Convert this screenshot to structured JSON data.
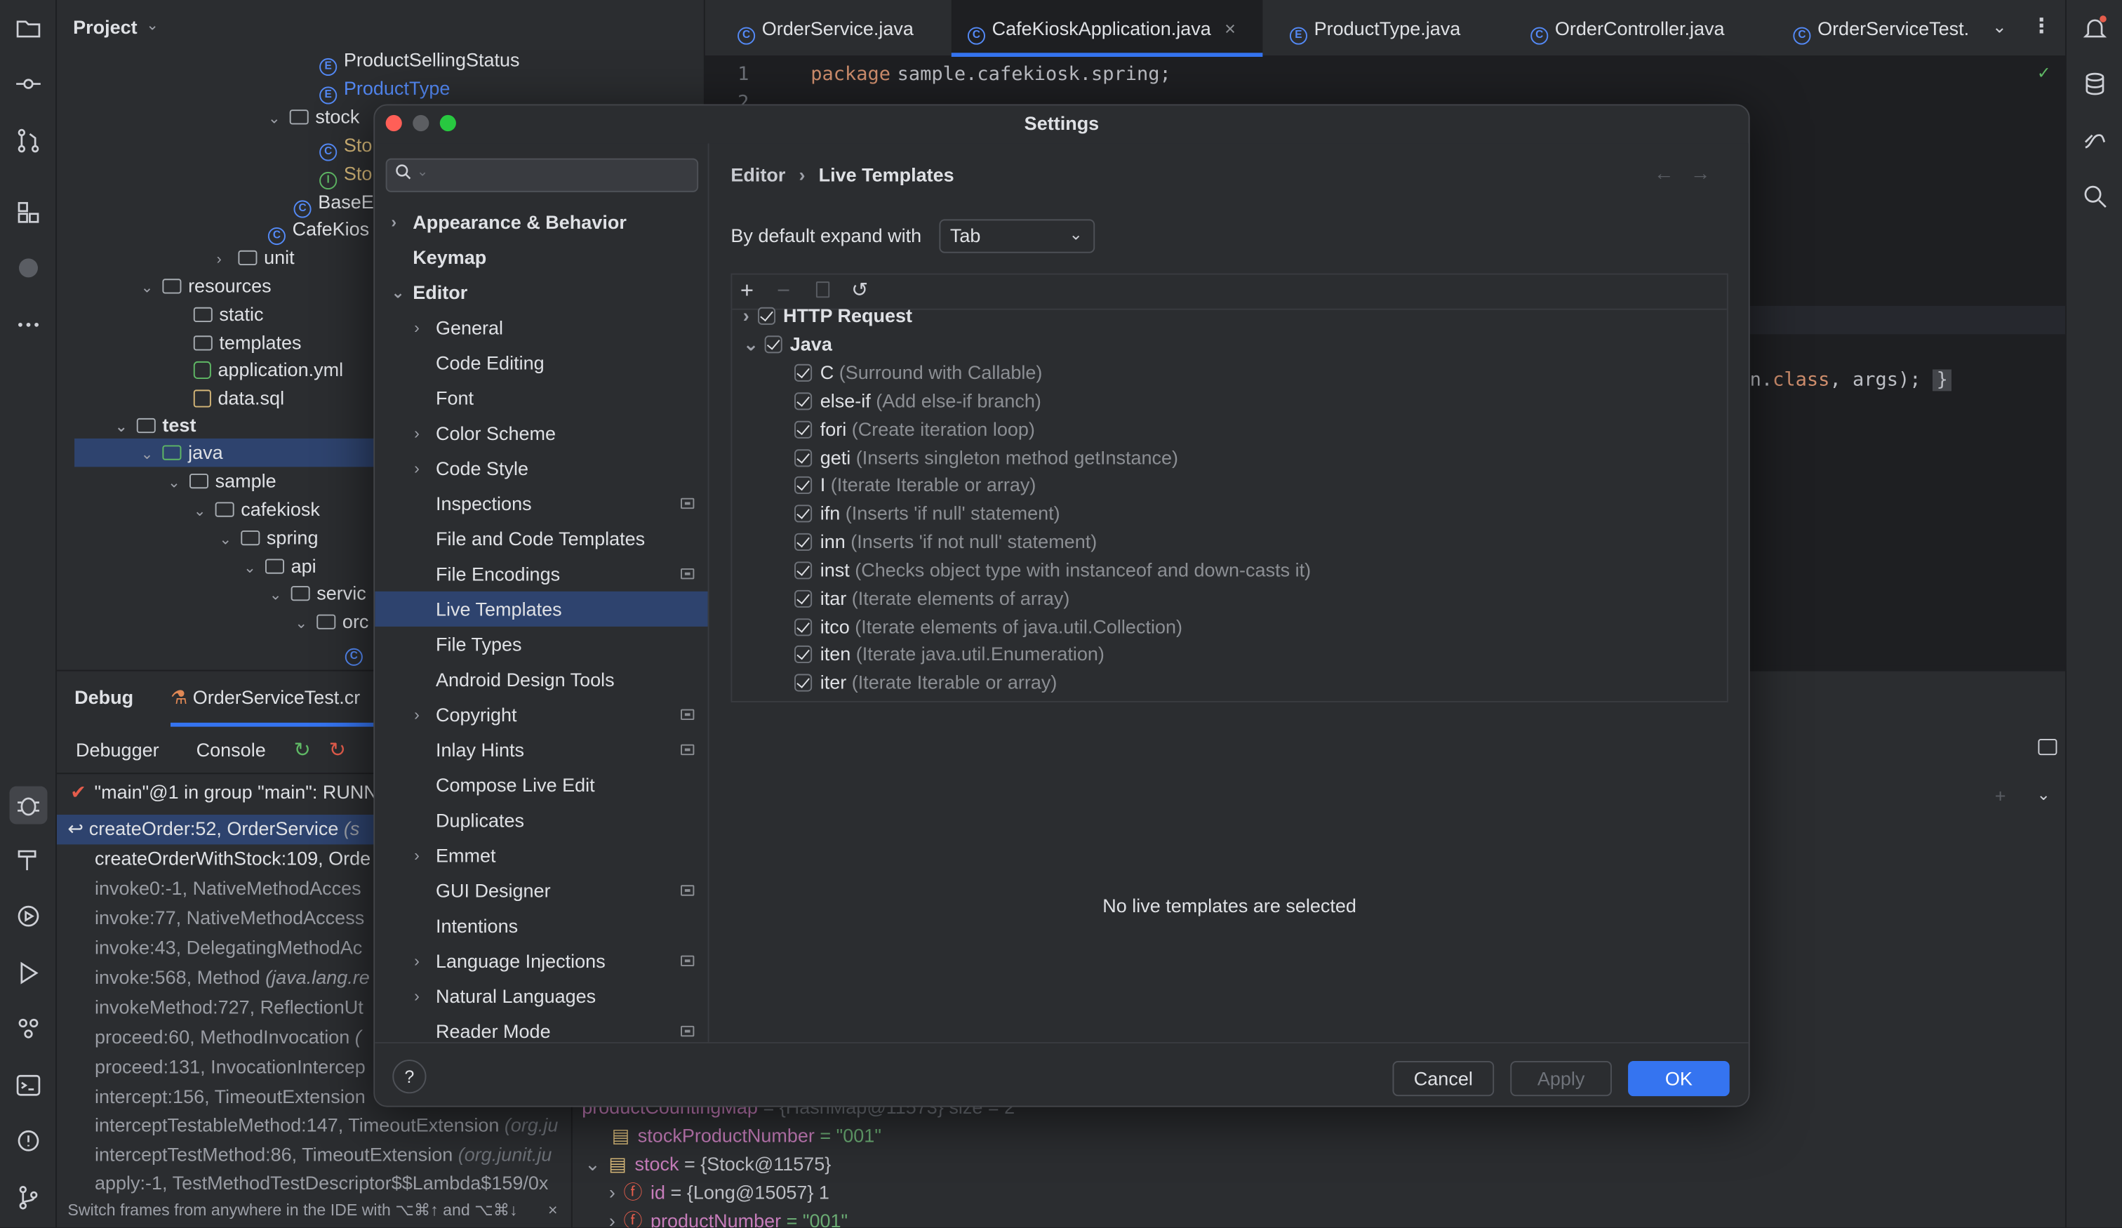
{
  "project": {
    "title": "Project",
    "tree": [
      {
        "label": "ProductSellingStatus",
        "kind": "enum"
      },
      {
        "label": "ProductType",
        "kind": "enum"
      },
      {
        "label": "stock",
        "kind": "folder"
      },
      {
        "label": "Sto",
        "kind": "class"
      },
      {
        "label": "Sto",
        "kind": "interface"
      },
      {
        "label": "BaseE",
        "kind": "class"
      },
      {
        "label": "CafeKios",
        "kind": "class"
      },
      {
        "label": "unit",
        "kind": "folder"
      },
      {
        "label": "resources",
        "kind": "folder"
      },
      {
        "label": "static",
        "kind": "folder"
      },
      {
        "label": "templates",
        "kind": "folder"
      },
      {
        "label": "application.yml",
        "kind": "file"
      },
      {
        "label": "data.sql",
        "kind": "file"
      },
      {
        "label": "test",
        "kind": "folder"
      },
      {
        "label": "java",
        "kind": "folder"
      },
      {
        "label": "sample",
        "kind": "folder"
      },
      {
        "label": "cafekiosk",
        "kind": "folder"
      },
      {
        "label": "spring",
        "kind": "folder"
      },
      {
        "label": "api",
        "kind": "folder"
      },
      {
        "label": "servic",
        "kind": "folder"
      },
      {
        "label": "orc",
        "kind": "folder"
      }
    ]
  },
  "tabs": [
    {
      "label": "OrderService.java"
    },
    {
      "label": "CafeKioskApplication.java",
      "active": true
    },
    {
      "label": "ProductType.java"
    },
    {
      "label": "OrderController.java"
    },
    {
      "label": "OrderServiceTest."
    }
  ],
  "editor": {
    "line1_number": "1",
    "line1_keyword": "package",
    "line1_text": "sample.cafekiosk.spring;",
    "line2_number": "2",
    "visible_fragment_a": "n.",
    "visible_fragment_b": "class",
    "visible_fragment_c": ", args);",
    "visible_fragment_d": "}"
  },
  "debug": {
    "title": "Debug",
    "config": "OrderServiceTest.cr",
    "tab_debugger": "Debugger",
    "tab_console": "Console",
    "thread": "\"main\"@1 in group \"main\": RUNN",
    "frames": [
      {
        "text": "createOrder:52, OrderService",
        "extra": "(s"
      },
      {
        "text": "createOrderWithStock:109, Orde",
        "extra": ""
      },
      {
        "text": "invoke0:-1, NativeMethodAcces",
        "extra": ""
      },
      {
        "text": "invoke:77, NativeMethodAccess",
        "extra": ""
      },
      {
        "text": "invoke:43, DelegatingMethodAc",
        "extra": ""
      },
      {
        "text": "invoke:568, Method",
        "extra": "(java.lang.re"
      },
      {
        "text": "invokeMethod:727, ReflectionUt",
        "extra": ""
      },
      {
        "text": "proceed:60, MethodInvocation",
        "extra": "("
      },
      {
        "text": "proceed:131, InvocationIntercep",
        "extra": ""
      },
      {
        "text": "intercept:156, TimeoutExtension",
        "extra": ""
      },
      {
        "text": "interceptTestableMethod:147, TimeoutExtension",
        "extra": "(org.ju"
      },
      {
        "text": "interceptTestMethod:86, TimeoutExtension",
        "extra": "(org.junit.ju"
      },
      {
        "text": "apply:-1, TestMethodTestDescriptor$$Lambda$159/0x",
        "extra": ""
      }
    ],
    "hint": "Switch frames from anywhere in the IDE with ⌥⌘↑ and ⌥⌘↓",
    "variables": [
      {
        "name": "productCountingMap",
        "value": "= {HashMap@11573}  size = 2"
      },
      {
        "name": "stockProductNumber",
        "value": "= \"001\""
      },
      {
        "name": "stock",
        "value": "= {Stock@11575}"
      },
      {
        "name": "id",
        "value": "= {Long@15057} 1"
      },
      {
        "name": "productNumber",
        "value": "= \"001\""
      }
    ]
  },
  "settings": {
    "title": "Settings",
    "search_placeholder": "",
    "nav": [
      {
        "label": "Appearance & Behavior",
        "level": 0,
        "chevron": "right",
        "bold": true
      },
      {
        "label": "Keymap",
        "level": 0,
        "bold": true
      },
      {
        "label": "Editor",
        "level": 0,
        "chevron": "down",
        "bold": true
      },
      {
        "label": "General",
        "level": 1,
        "chevron": "right"
      },
      {
        "label": "Code Editing",
        "level": 1
      },
      {
        "label": "Font",
        "level": 1
      },
      {
        "label": "Color Scheme",
        "level": 1,
        "chevron": "right"
      },
      {
        "label": "Code Style",
        "level": 1,
        "chevron": "right"
      },
      {
        "label": "Inspections",
        "level": 1,
        "badge": true
      },
      {
        "label": "File and Code Templates",
        "level": 1
      },
      {
        "label": "File Encodings",
        "level": 1,
        "badge": true
      },
      {
        "label": "Live Templates",
        "level": 1,
        "selected": true
      },
      {
        "label": "File Types",
        "level": 1
      },
      {
        "label": "Android Design Tools",
        "level": 1
      },
      {
        "label": "Copyright",
        "level": 1,
        "chevron": "right",
        "badge": true
      },
      {
        "label": "Inlay Hints",
        "level": 1,
        "badge": true
      },
      {
        "label": "Compose Live Edit",
        "level": 1
      },
      {
        "label": "Duplicates",
        "level": 1
      },
      {
        "label": "Emmet",
        "level": 1,
        "chevron": "right"
      },
      {
        "label": "GUI Designer",
        "level": 1,
        "badge": true
      },
      {
        "label": "Intentions",
        "level": 1
      },
      {
        "label": "Language Injections",
        "level": 1,
        "chevron": "right",
        "badge": true
      },
      {
        "label": "Natural Languages",
        "level": 1,
        "chevron": "right"
      },
      {
        "label": "Reader Mode",
        "level": 1,
        "badge": true
      }
    ],
    "breadcrumb_parent": "Editor",
    "breadcrumb_sep": "›",
    "breadcrumb_current": "Live Templates",
    "expand_label": "By default expand with",
    "expand_value": "Tab",
    "groups": [
      {
        "label": "HTTP Request",
        "checked": true,
        "expanded": false
      },
      {
        "label": "Java",
        "checked": true,
        "expanded": true
      }
    ],
    "templates": [
      {
        "abbr": "C",
        "desc": "(Surround with Callable)"
      },
      {
        "abbr": "else-if",
        "desc": "(Add else-if branch)"
      },
      {
        "abbr": "fori",
        "desc": "(Create iteration loop)"
      },
      {
        "abbr": "geti",
        "desc": "(Inserts singleton method getInstance)"
      },
      {
        "abbr": "I",
        "desc": "(Iterate Iterable or array)"
      },
      {
        "abbr": "ifn",
        "desc": "(Inserts 'if null' statement)"
      },
      {
        "abbr": "inn",
        "desc": "(Inserts 'if not null' statement)"
      },
      {
        "abbr": "inst",
        "desc": "(Checks object type with instanceof and down-casts it)"
      },
      {
        "abbr": "itar",
        "desc": "(Iterate elements of array)"
      },
      {
        "abbr": "itco",
        "desc": "(Iterate elements of java.util.Collection)"
      },
      {
        "abbr": "iten",
        "desc": "(Iterate java.util.Enumeration)"
      },
      {
        "abbr": "iter",
        "desc": "(Iterate Iterable or array)"
      }
    ],
    "empty_message": "No live templates are selected",
    "help": "?",
    "cancel": "Cancel",
    "apply": "Apply",
    "ok": "OK"
  },
  "colors": {
    "accent": "#3574f0",
    "selection": "#2e436e",
    "keyword": "#cf8e6d",
    "string": "#6aab73",
    "field": "#c77dbb"
  }
}
